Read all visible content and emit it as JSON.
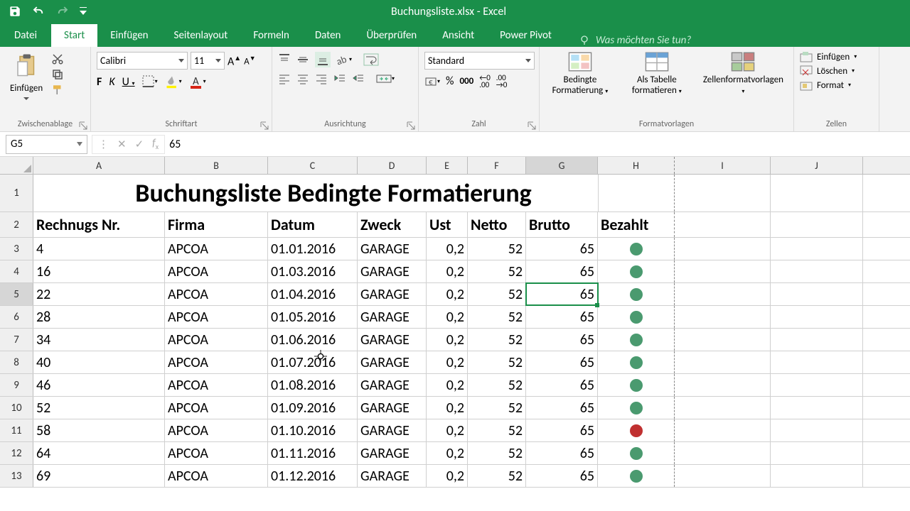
{
  "app": {
    "title": "Buchungsliste.xlsx - Excel"
  },
  "tabs": {
    "items": [
      "Datei",
      "Start",
      "Einfügen",
      "Seitenlayout",
      "Formeln",
      "Daten",
      "Überprüfen",
      "Ansicht",
      "Power Pivot"
    ],
    "active": 1,
    "tellme": "Was möchten Sie tun?"
  },
  "ribbon": {
    "clipboard": {
      "label": "Zwischenablage",
      "paste": "Einfügen"
    },
    "font": {
      "label": "Schriftart",
      "name": "Calibri",
      "size": "11",
      "buttons": {
        "bold": "F",
        "italic": "K",
        "underline": "U"
      }
    },
    "alignment": {
      "label": "Ausrichtung"
    },
    "number": {
      "label": "Zahl",
      "format": "Standard"
    },
    "styles": {
      "label": "Formatvorlagen",
      "condfmt": "Bedingte Formatierung",
      "table": "Als Tabelle formatieren",
      "cellstyles": "Zellenformatvorlagen"
    },
    "cells": {
      "label": "Zellen",
      "insert": "Einfügen",
      "delete": "Löschen",
      "format": "Format"
    }
  },
  "fbar": {
    "ref": "G5",
    "value": "65"
  },
  "grid": {
    "columns": [
      "A",
      "B",
      "C",
      "D",
      "E",
      "F",
      "G",
      "H",
      "I",
      "J"
    ],
    "title": "Buchungsliste Bedingte Formatierung",
    "headers": [
      "Rechnugs Nr.",
      "Firma",
      "Datum",
      "Zweck",
      "Ust",
      "Netto",
      "Brutto",
      "Bezahlt"
    ],
    "rows": [
      {
        "n": 3,
        "a": "4",
        "b": "APCOA",
        "c": "01.01.2016",
        "d": "GARAGE",
        "e": "0,2",
        "f": "52",
        "g": "65",
        "paid": true
      },
      {
        "n": 4,
        "a": "16",
        "b": "APCOA",
        "c": "01.03.2016",
        "d": "GARAGE",
        "e": "0,2",
        "f": "52",
        "g": "65",
        "paid": true
      },
      {
        "n": 5,
        "a": "22",
        "b": "APCOA",
        "c": "01.04.2016",
        "d": "GARAGE",
        "e": "0,2",
        "f": "52",
        "g": "65",
        "paid": true
      },
      {
        "n": 6,
        "a": "28",
        "b": "APCOA",
        "c": "01.05.2016",
        "d": "GARAGE",
        "e": "0,2",
        "f": "52",
        "g": "65",
        "paid": true
      },
      {
        "n": 7,
        "a": "34",
        "b": "APCOA",
        "c": "01.06.2016",
        "d": "GARAGE",
        "e": "0,2",
        "f": "52",
        "g": "65",
        "paid": true
      },
      {
        "n": 8,
        "a": "40",
        "b": "APCOA",
        "c": "01.07.2016",
        "d": "GARAGE",
        "e": "0,2",
        "f": "52",
        "g": "65",
        "paid": true
      },
      {
        "n": 9,
        "a": "46",
        "b": "APCOA",
        "c": "01.08.2016",
        "d": "GARAGE",
        "e": "0,2",
        "f": "52",
        "g": "65",
        "paid": true
      },
      {
        "n": 10,
        "a": "52",
        "b": "APCOA",
        "c": "01.09.2016",
        "d": "GARAGE",
        "e": "0,2",
        "f": "52",
        "g": "65",
        "paid": true
      },
      {
        "n": 11,
        "a": "58",
        "b": "APCOA",
        "c": "01.10.2016",
        "d": "GARAGE",
        "e": "0,2",
        "f": "52",
        "g": "65",
        "paid": false
      },
      {
        "n": 12,
        "a": "64",
        "b": "APCOA",
        "c": "01.11.2016",
        "d": "GARAGE",
        "e": "0,2",
        "f": "52",
        "g": "65",
        "paid": true
      },
      {
        "n": 13,
        "a": "69",
        "b": "APCOA",
        "c": "01.12.2016",
        "d": "GARAGE",
        "e": "0,2",
        "f": "52",
        "g": "65",
        "paid": true
      }
    ],
    "selected": {
      "row": 5,
      "col": "G"
    }
  }
}
